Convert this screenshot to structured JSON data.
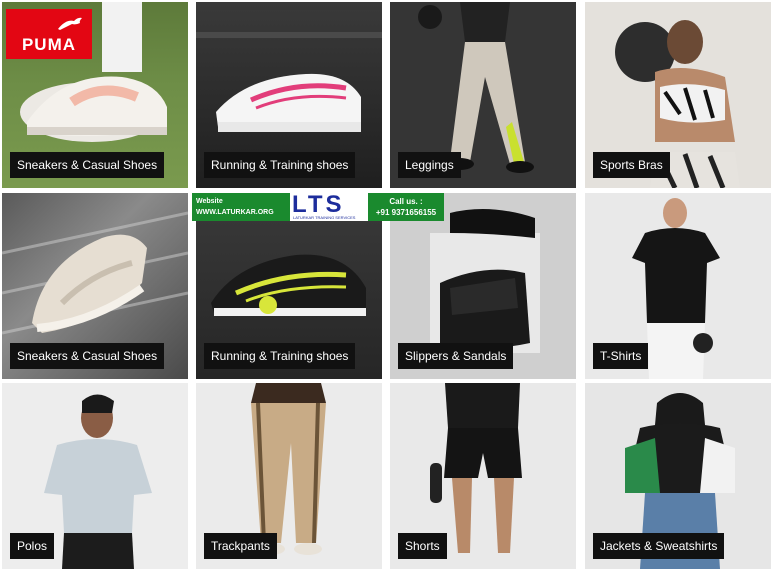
{
  "brand": {
    "logo_text": "PUMA"
  },
  "tiles": [
    {
      "label": "Sneakers & Casual Shoes"
    },
    {
      "label": "Running & Training shoes"
    },
    {
      "label": "Leggings"
    },
    {
      "label": "Sports Bras"
    },
    {
      "label": "Sneakers & Casual Shoes"
    },
    {
      "label": "Running & Training shoes"
    },
    {
      "label": "Slippers & Sandals"
    },
    {
      "label": "T-Shirts"
    },
    {
      "label": "Polos"
    },
    {
      "label": "Trackpants"
    },
    {
      "label": "Shorts"
    },
    {
      "label": "Jackets & Sweatshirts"
    }
  ],
  "banner": {
    "website_label": "Website",
    "website_url": "WWW.LATURKAR.ORG",
    "logo_text": "LTS",
    "logo_sub": "LATURKAR TRAINING SERVICES",
    "call_label": "Call us. :",
    "phone": "+91 9371656155"
  }
}
